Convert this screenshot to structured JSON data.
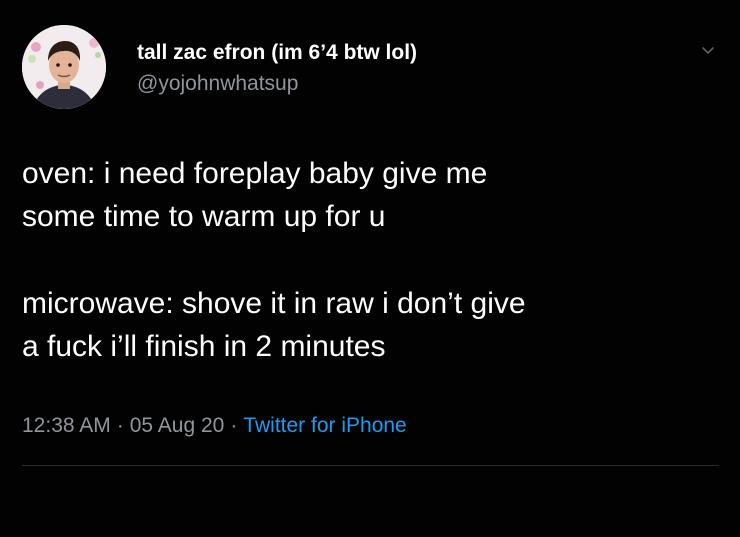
{
  "tweet": {
    "author": {
      "display_name": "tall zac efron (im 6’4 btw lol)",
      "handle": "@yojohnwhatsup",
      "avatar_icon": "profile-photo"
    },
    "text_paragraphs": [
      "oven: i need foreplay baby give me\nsome time to warm up for u",
      "microwave: shove it in raw i don’t give\na fuck i’ll finish in 2 minutes"
    ],
    "meta": {
      "time": "12:38 AM",
      "separator": "·",
      "date": "05 Aug 20",
      "source": "Twitter for iPhone"
    },
    "menu_icon": "chevron-down-icon"
  },
  "colors": {
    "background": "#000000",
    "text": "#ffffff",
    "secondary_text": "#8f969c",
    "link": "#1d9bf0"
  }
}
